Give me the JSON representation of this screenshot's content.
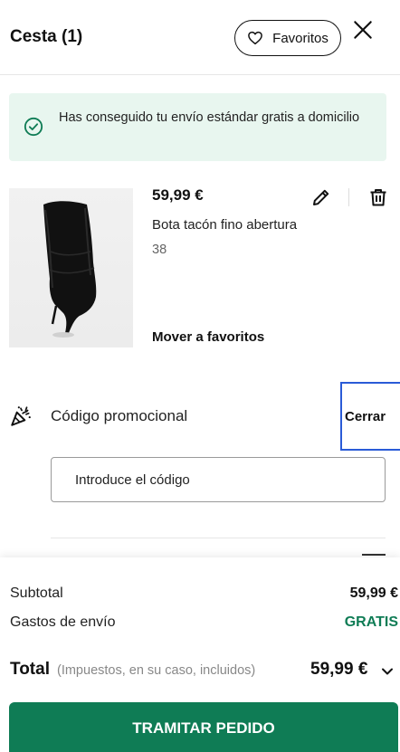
{
  "header": {
    "title": "Cesta (1)",
    "favorites_label": "Favoritos"
  },
  "banner": {
    "text": "Has conseguido tu envío estándar gratis a domicilio"
  },
  "cart": {
    "items": [
      {
        "price": "59,99 €",
        "name": "Bota tacón fino abertura",
        "size": "38",
        "move_to_favorites": "Mover a favoritos"
      }
    ]
  },
  "promo": {
    "label": "Código promocional",
    "close_label": "Cerrar",
    "input_placeholder": "Introduce el código"
  },
  "summary": {
    "subtotal_label": "Subtotal",
    "subtotal_value": "59,99 €",
    "shipping_label": "Gastos de envío",
    "shipping_value": "GRATIS",
    "total_label": "Total",
    "total_note": "(Impuestos, en su caso, incluidos)",
    "total_value": "59,99 €",
    "checkout_label": "TRAMITAR PEDIDO"
  },
  "colors": {
    "accent_green": "#0f7c55",
    "banner_bg": "#e8f6ef",
    "focus_blue": "#2a5bd7"
  },
  "icons": [
    "heart-icon",
    "close-icon",
    "check-circle-icon",
    "pencil-icon",
    "trash-icon",
    "party-popper-icon",
    "chevron-down-icon"
  ]
}
